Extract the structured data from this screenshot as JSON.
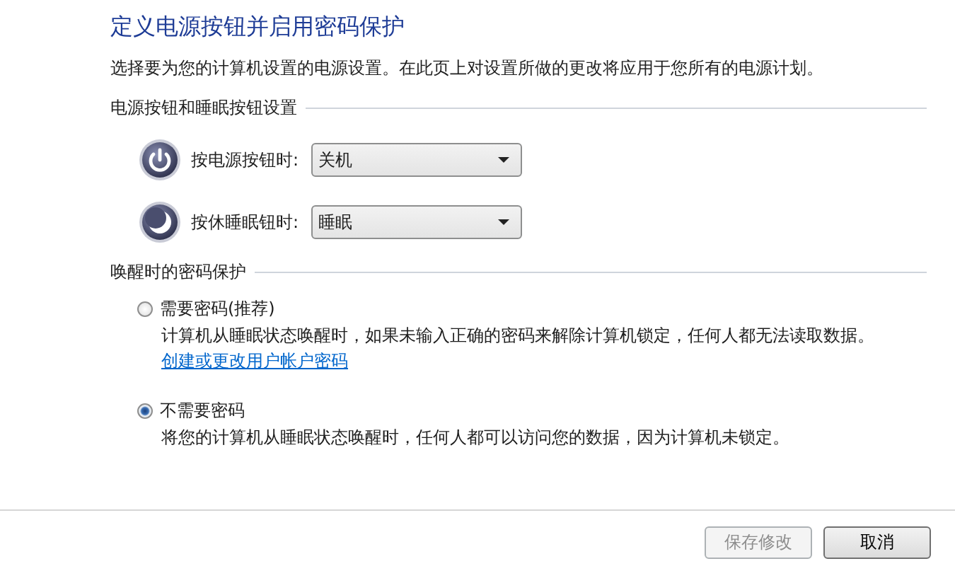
{
  "header": {
    "title": "定义电源按钮并启用密码保护",
    "description": "选择要为您的计算机设置的电源设置。在此页上对设置所做的更改将应用于您所有的电源计划。"
  },
  "power_settings": {
    "heading": "电源按钮和睡眠按钮设置",
    "rows": [
      {
        "kind": "power",
        "label": "按电源按钮时:",
        "value": "关机"
      },
      {
        "kind": "sleep",
        "label": "按休睡眠钮时:",
        "value": "睡眠"
      }
    ]
  },
  "wake_password": {
    "heading": "唤醒时的密码保护",
    "options": [
      {
        "label": "需要密码(推荐)",
        "description": "计算机从睡眠状态唤醒时，如果未输入正确的密码来解除计算机锁定，任何人都无法读取数据。",
        "link": "创建或更改用户帐户密码",
        "selected": false
      },
      {
        "label": "不需要密码",
        "description": "将您的计算机从睡眠状态唤醒时，任何人都可以访问您的数据，因为计算机未锁定。",
        "selected": true
      }
    ]
  },
  "buttons": [
    {
      "label": "保存修改",
      "disabled": true
    },
    {
      "label": "取消",
      "disabled": false
    }
  ]
}
